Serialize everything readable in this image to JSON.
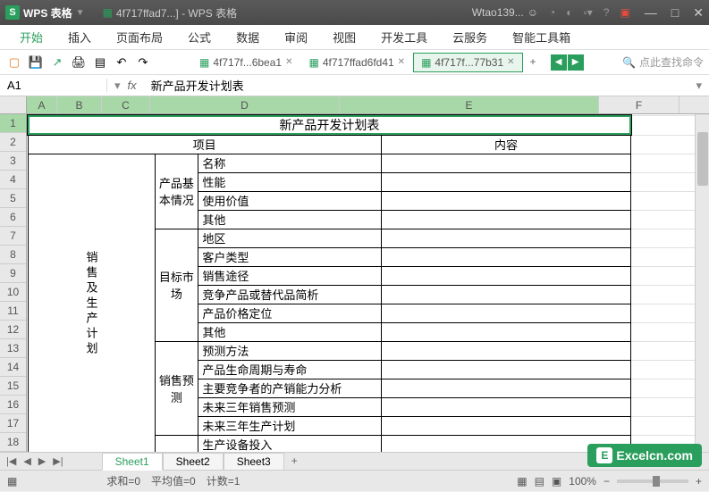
{
  "titlebar": {
    "app_name": "WPS 表格",
    "doc_title": "4f717ffad7...] - WPS 表格",
    "user_name": "Wtao139..."
  },
  "menus": [
    "开始",
    "插入",
    "页面布局",
    "公式",
    "数据",
    "审阅",
    "视图",
    "开发工具",
    "云服务",
    "智能工具箱"
  ],
  "file_tabs": [
    {
      "label": "4f717f...6bea1",
      "active": false
    },
    {
      "label": "4f717ffad6fd41",
      "active": false
    },
    {
      "label": "4f717f...77b31",
      "active": true
    }
  ],
  "search_placeholder": "点此查找命令",
  "formula_bar": {
    "cell_ref": "A1",
    "fx": "fx",
    "value": "新产品开发计划表"
  },
  "columns": [
    "A",
    "B",
    "C",
    "D",
    "E",
    "F"
  ],
  "rows": [
    1,
    2,
    3,
    4,
    5,
    6,
    7,
    8,
    9,
    10,
    11,
    12,
    13,
    14,
    15,
    16,
    17,
    18
  ],
  "chart_data": {
    "type": "table",
    "title": "新产品开发计划表",
    "header_row": [
      "项目",
      "内容"
    ],
    "sections": [
      {
        "group": "销售及生产计划",
        "subgroups": [
          {
            "name": "产品基本情况",
            "items": [
              "名称",
              "性能",
              "使用价值",
              "其他"
            ]
          },
          {
            "name": "目标市场",
            "items": [
              "地区",
              "客户类型",
              "销售途径",
              "竞争产品或替代品简析",
              "产品价格定位",
              "其他"
            ]
          },
          {
            "name": "销售预测",
            "items": [
              "预测方法",
              "产品生命周期与寿命",
              "主要竞争者的产销能力分析",
              "未来三年销售预测",
              "未来三年生产计划"
            ]
          }
        ],
        "extra_row": "生产设备投入"
      }
    ]
  },
  "sheet_tabs": [
    "Sheet1",
    "Sheet2",
    "Sheet3"
  ],
  "statusbar": {
    "sum": "求和=0",
    "avg": "平均值=0",
    "count": "计数=1",
    "zoom": "100%"
  },
  "watermark": "Excelcn.com"
}
